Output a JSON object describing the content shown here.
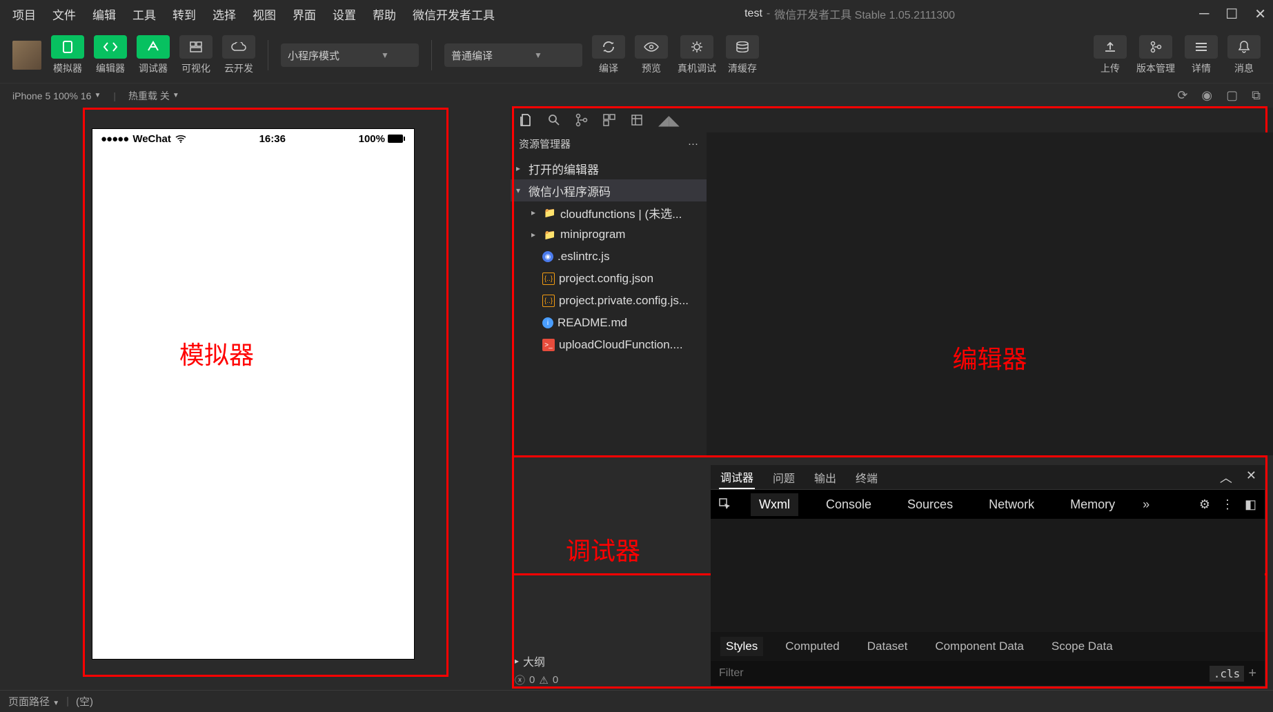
{
  "window": {
    "project": "test",
    "title_suffix": "微信开发者工具 Stable 1.05.2111300"
  },
  "menu": [
    "项目",
    "文件",
    "编辑",
    "工具",
    "转到",
    "选择",
    "视图",
    "界面",
    "设置",
    "帮助",
    "微信开发者工具"
  ],
  "toolbar": {
    "buttons": [
      {
        "id": "simulator",
        "label": "模拟器",
        "green": true,
        "icon": "phone"
      },
      {
        "id": "editor",
        "label": "编辑器",
        "green": true,
        "icon": "code"
      },
      {
        "id": "debugger",
        "label": "调试器",
        "green": true,
        "icon": "bug"
      },
      {
        "id": "visual",
        "label": "可视化",
        "green": false,
        "icon": "grid"
      },
      {
        "id": "cloud",
        "label": "云开发",
        "green": false,
        "icon": "cloud"
      }
    ],
    "mode_select": "小程序模式",
    "compile_select": "普通编译",
    "actions": [
      {
        "id": "compile",
        "label": "编译",
        "icon": "refresh"
      },
      {
        "id": "preview",
        "label": "预览",
        "icon": "eye"
      },
      {
        "id": "realdebug",
        "label": "真机调试",
        "icon": "bug2"
      },
      {
        "id": "clearcache",
        "label": "清缓存",
        "icon": "layers"
      }
    ],
    "right_actions": [
      {
        "id": "upload",
        "label": "上传",
        "icon": "upload"
      },
      {
        "id": "version",
        "label": "版本管理",
        "icon": "branch"
      },
      {
        "id": "details",
        "label": "详情",
        "icon": "menu"
      },
      {
        "id": "notify",
        "label": "消息",
        "icon": "bell"
      }
    ]
  },
  "device_bar": {
    "device": "iPhone 5 100% 16",
    "hotreload": "热重载 关"
  },
  "phone": {
    "carrier": "WeChat",
    "time": "16:36",
    "battery": "100%"
  },
  "annotations": {
    "simulator": "模拟器",
    "editor": "编辑器",
    "debugger": "调试器"
  },
  "explorer": {
    "title": "资源管理器",
    "sections": {
      "open_editors": "打开的编辑器",
      "project_root": "微信小程序源码"
    },
    "tree": [
      {
        "name": "cloudfunctions | (未选...",
        "type": "folder",
        "expandable": true
      },
      {
        "name": "miniprogram",
        "type": "folder-dark",
        "expandable": true
      },
      {
        "name": ".eslintrc.js",
        "type": "js"
      },
      {
        "name": "project.config.json",
        "type": "json"
      },
      {
        "name": "project.private.config.js...",
        "type": "json"
      },
      {
        "name": "README.md",
        "type": "md"
      },
      {
        "name": "uploadCloudFunction....",
        "type": "sh"
      }
    ],
    "outline": "大纲",
    "problems": {
      "errors": "0",
      "warnings": "0"
    }
  },
  "debugger": {
    "top_tabs": [
      "调试器",
      "问题",
      "输出",
      "终端"
    ],
    "devtools_tabs": [
      "Wxml",
      "Console",
      "Sources",
      "Network",
      "Memory"
    ],
    "sub_tabs": [
      "Styles",
      "Computed",
      "Dataset",
      "Component Data",
      "Scope Data"
    ],
    "filter_placeholder": "Filter",
    "cls_label": ".cls"
  },
  "status_bar": {
    "page_path_label": "页面路径",
    "value": "(空)"
  }
}
